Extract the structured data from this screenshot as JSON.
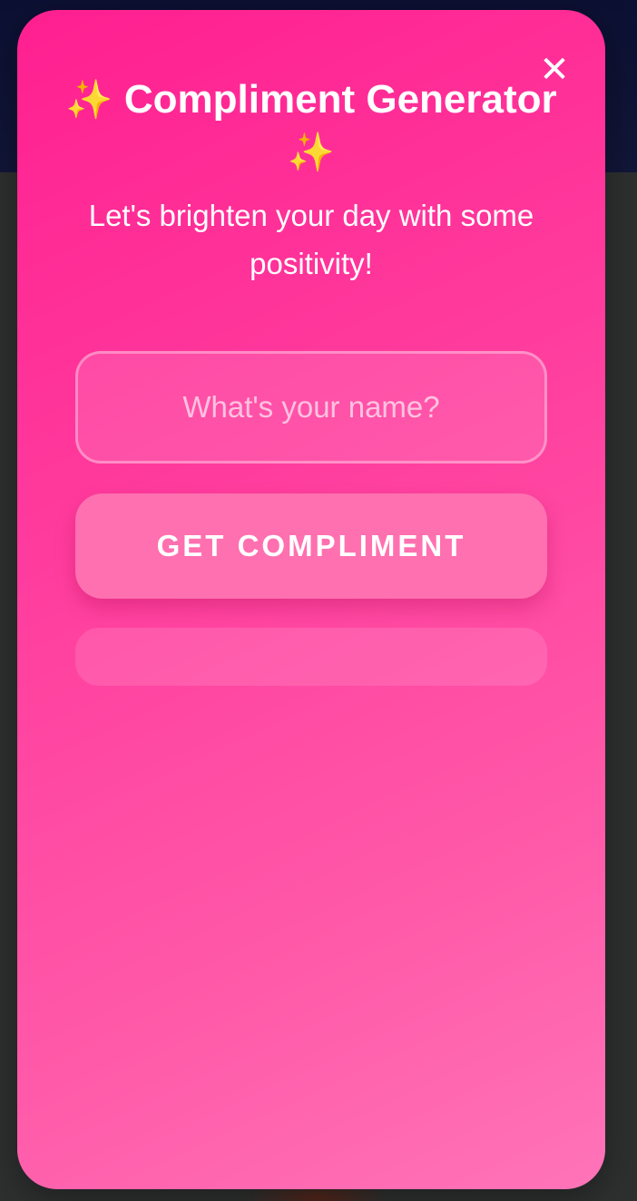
{
  "modal": {
    "close_label": "✕",
    "title_prefix": "✨",
    "title_text": "Compliment Generator",
    "title_suffix": "✨",
    "subtitle": "Let's brighten your day with some positivity!",
    "name_input": {
      "placeholder": "What's your name?",
      "value": ""
    },
    "get_button_label": "GET COMPLIMENT",
    "result_text": ""
  },
  "colors": {
    "modal_gradient_start": "#ff1f90",
    "modal_gradient_end": "#ff74b8",
    "button": "#ff70b0",
    "backdrop_top": "#0c1033",
    "backdrop": "#2e3030"
  },
  "icons": {
    "close": "close-icon",
    "sparkles": "sparkles-icon"
  }
}
